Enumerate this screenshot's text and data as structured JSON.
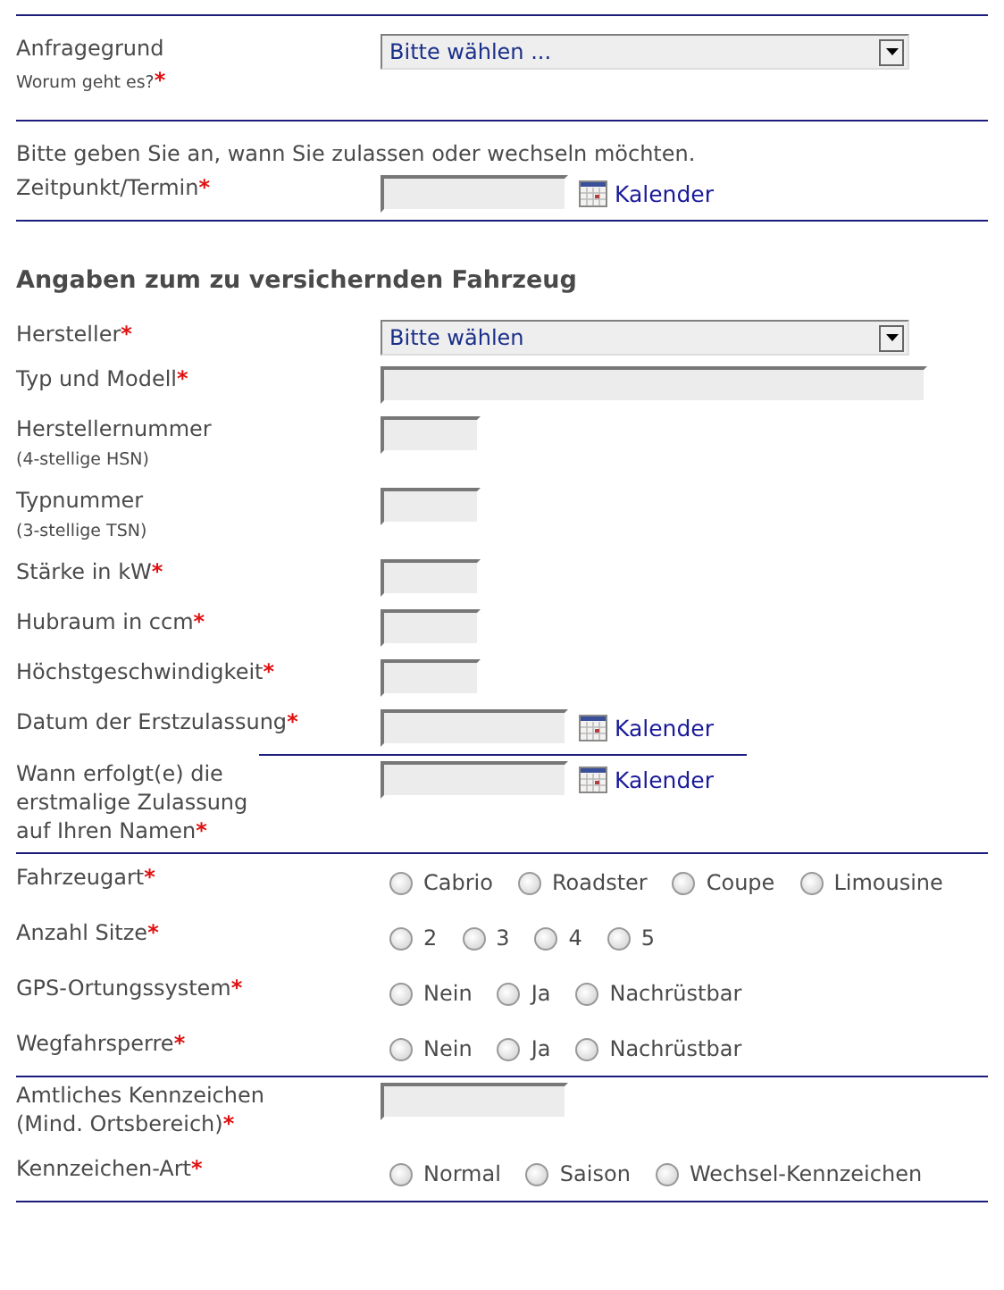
{
  "rows": [
    {
      "kind": "rule"
    },
    {
      "kind": "select",
      "label": [
        "Anfragegrund"
      ],
      "note": "Worum geht es?",
      "mark": "*",
      "value": "Bitte wählen ..."
    },
    {
      "kind": "rule"
    },
    {
      "kind": "intro",
      "text": "Bitte geben Sie an, wann Sie zulassen oder wechseln möchten."
    },
    {
      "kind": "date",
      "label": [
        "Zeitpunkt/Termin"
      ],
      "mark": "*",
      "link": "Kalender"
    },
    {
      "kind": "rule"
    },
    {
      "kind": "heading",
      "text": "Angaben zum zu versichernden Fahrzeug"
    },
    {
      "kind": "select",
      "label": [
        "Hersteller"
      ],
      "mark": "*",
      "value": "Bitte wählen"
    },
    {
      "kind": "text_long",
      "label": [
        "Typ und Modell"
      ],
      "mark": "*"
    },
    {
      "kind": "text_short",
      "label": [
        "Herstellernummer"
      ],
      "note": "(4-stellige HSN)"
    },
    {
      "kind": "text_short",
      "label": [
        "Typnummer"
      ],
      "note": "(3-stellige TSN)"
    },
    {
      "kind": "text_short",
      "label": [
        "Stärke in kW"
      ],
      "mark": "*"
    },
    {
      "kind": "text_short",
      "label": [
        "Hubraum in ccm"
      ],
      "mark": "*"
    },
    {
      "kind": "text_short",
      "label": [
        "Höchstgeschwindigkeit"
      ],
      "mark": "*"
    },
    {
      "kind": "date",
      "label": [
        "Datum der Erstzulassung"
      ],
      "mark": "*",
      "link": "Kalender"
    },
    {
      "kind": "rule_short"
    },
    {
      "kind": "date",
      "label": [
        "Wann erfolgt(e) die",
        "erstmalige Zulassung",
        "auf Ihren Namen"
      ],
      "mark": "*",
      "link": "Kalender"
    },
    {
      "kind": "rule"
    },
    {
      "kind": "radio",
      "label": [
        "Fahrzeugart"
      ],
      "mark": "*",
      "options": [
        {
          "label": "Cabrio",
          "selected": false
        },
        {
          "label": "Roadster",
          "selected": false
        },
        {
          "label": "Coupe",
          "selected": false
        },
        {
          "label": "Limousine",
          "selected": false
        }
      ]
    },
    {
      "kind": "radio",
      "label": [
        "Anzahl Sitze"
      ],
      "mark": "*",
      "options": [
        {
          "label": "2",
          "selected": false
        },
        {
          "label": "3",
          "selected": false
        },
        {
          "label": "4",
          "selected": false
        },
        {
          "label": "5",
          "selected": false
        }
      ]
    },
    {
      "kind": "radio",
      "label": [
        "GPS-Ortungssystem"
      ],
      "mark": "*",
      "options": [
        {
          "label": "Nein",
          "selected": false
        },
        {
          "label": "Ja",
          "selected": false
        },
        {
          "label": "Nachrüstbar",
          "selected": false
        }
      ]
    },
    {
      "kind": "radio",
      "label": [
        "Wegfahrsperre"
      ],
      "mark": "*",
      "options": [
        {
          "label": "Nein",
          "selected": false
        },
        {
          "label": "Ja",
          "selected": false
        },
        {
          "label": "Nachrüstbar",
          "selected": false
        }
      ]
    },
    {
      "kind": "rule"
    },
    {
      "kind": "text_medium",
      "label": [
        "Amtliches Kennzeichen",
        "(Mind. Ortsbereich)"
      ],
      "mark": "*"
    },
    {
      "kind": "radio",
      "label": [
        "Kennzeichen-Art"
      ],
      "mark": "*",
      "options": [
        {
          "label": "Normal",
          "selected": false
        },
        {
          "label": "Saison",
          "selected": false
        },
        {
          "label": "Wechsel-Kennzeichen",
          "selected": false
        }
      ]
    },
    {
      "kind": "rule"
    }
  ]
}
